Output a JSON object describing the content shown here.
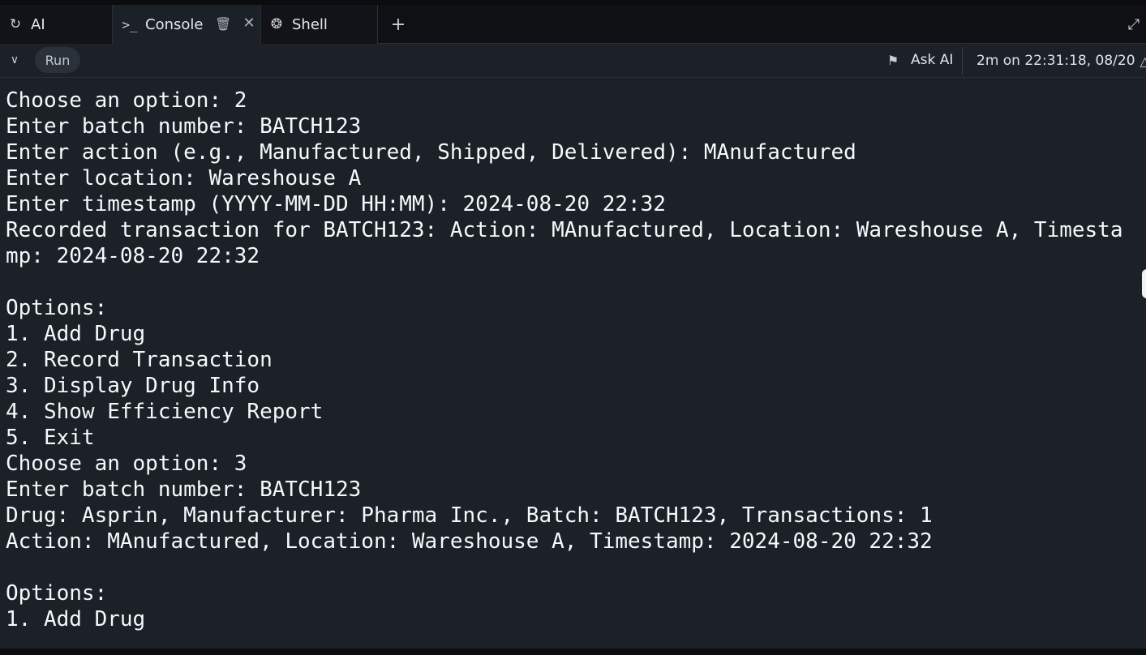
{
  "tabs": [
    {
      "label": "AI",
      "icon": "ai-icon"
    },
    {
      "label": "Console",
      "icon": "console-icon"
    },
    {
      "label": "Shell",
      "icon": "shell-icon"
    }
  ],
  "add_tab_icon": "+",
  "toolbar": {
    "run_label": "Run",
    "ask_ai_label": "Ask AI",
    "status": "2m on 22:31:18, 08/20"
  },
  "console": {
    "lines": [
      "Choose an option: 2",
      "Enter batch number: BATCH123",
      "Enter action (e.g., Manufactured, Shipped, Delivered): MAnufactured",
      "Enter location: Wareshouse A",
      "Enter timestamp (YYYY-MM-DD HH:MM): 2024-08-20 22:32",
      "Recorded transaction for BATCH123: Action: MAnufactured, Location: Wareshouse A, Timesta",
      "mp: 2024-08-20 22:32",
      "",
      "Options:",
      "1. Add Drug",
      "2. Record Transaction",
      "3. Display Drug Info",
      "4. Show Efficiency Report",
      "5. Exit",
      "Choose an option: 3",
      "Enter batch number: BATCH123",
      "Drug: Asprin, Manufacturer: Pharma Inc., Batch: BATCH123, Transactions: 1",
      "Action: MAnufactured, Location: Wareshouse A, Timestamp: 2024-08-20 22:32",
      "",
      "Options:",
      "1. Add Drug"
    ]
  },
  "colors": {
    "background": "#1c2027",
    "tabbar": "#0e1014",
    "text": "#f5f9fc",
    "run_button": "#2b313a"
  }
}
